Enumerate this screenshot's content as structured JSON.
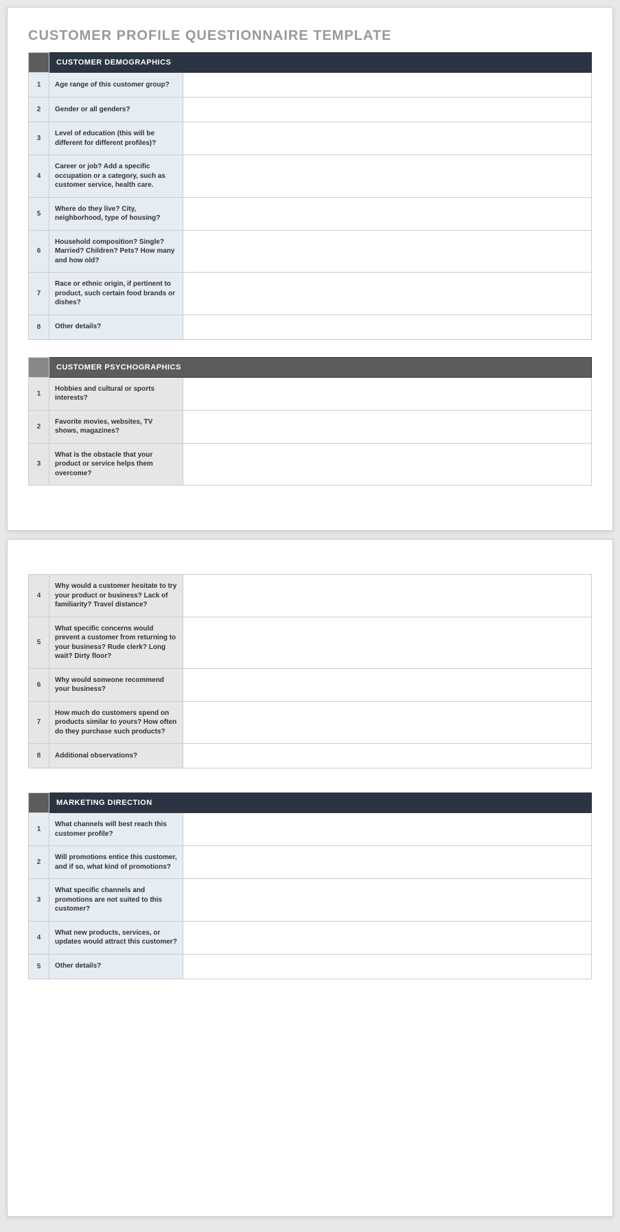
{
  "title": "CUSTOMER PROFILE QUESTIONNAIRE TEMPLATE",
  "sections": {
    "demographics": {
      "header": "CUSTOMER DEMOGRAPHICS",
      "rows": [
        {
          "num": "1",
          "q": "Age range of this customer group?"
        },
        {
          "num": "2",
          "q": "Gender or all genders?"
        },
        {
          "num": "3",
          "q": "Level of education (this will be different for different profiles)?"
        },
        {
          "num": "4",
          "q": "Career or job? Add a specific occupation or a category, such as customer service, health care."
        },
        {
          "num": "5",
          "q": "Where do they live? City, neighborhood, type of housing?"
        },
        {
          "num": "6",
          "q": "Household composition? Single? Married? Children? Pets? How many and how old?"
        },
        {
          "num": "7",
          "q": "Race or ethnic origin, if pertinent to product, such certain food brands or dishes?"
        },
        {
          "num": "8",
          "q": "Other details?"
        }
      ]
    },
    "psychographics": {
      "header": "CUSTOMER PSYCHOGRAPHICS",
      "rows_p1": [
        {
          "num": "1",
          "q": "Hobbies and cultural or sports interests?"
        },
        {
          "num": "2",
          "q": "Favorite movies, websites, TV shows, magazines?"
        },
        {
          "num": "3",
          "q": "What is the obstacle that your product or service helps them overcome?"
        }
      ],
      "rows_p2": [
        {
          "num": "4",
          "q": "Why would a customer hesitate to try your product or business? Lack of familiarity? Travel distance?"
        },
        {
          "num": "5",
          "q": "What specific concerns would prevent a customer from returning to your business? Rude clerk? Long wait? Dirty floor?"
        },
        {
          "num": "6",
          "q": "Why would someone recommend your business?"
        },
        {
          "num": "7",
          "q": "How much do customers spend on products similar to yours? How often do they purchase such products?"
        },
        {
          "num": "8",
          "q": "Additional observations?"
        }
      ]
    },
    "marketing": {
      "header": "MARKETING DIRECTION",
      "rows": [
        {
          "num": "1",
          "q": "What channels will best reach this customer profile?"
        },
        {
          "num": "2",
          "q": "Will promotions entice this customer, and if so, what kind of promotions?"
        },
        {
          "num": "3",
          "q": "What specific channels and promotions are not suited to this customer?"
        },
        {
          "num": "4",
          "q": "What new products, services, or updates would attract this customer?"
        },
        {
          "num": "5",
          "q": "Other details?"
        }
      ]
    }
  }
}
